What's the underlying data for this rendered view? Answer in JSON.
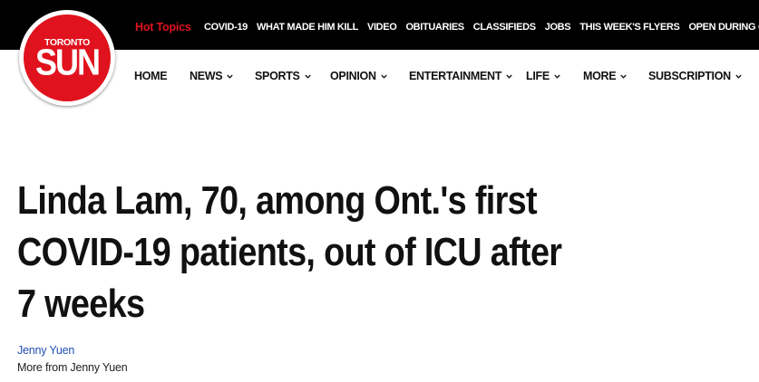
{
  "brand": {
    "logo_top_text": "TORONTO",
    "logo_main_text": "SUN",
    "colors": {
      "red": "#e0121d",
      "black": "#000000",
      "link_blue": "#1f4fb4"
    }
  },
  "topbar": {
    "hot_topics_label": "Hot Topics",
    "topics": [
      "COVID-19",
      "WHAT MADE HIM KILL",
      "VIDEO",
      "OBITUARIES",
      "CLASSIFIEDS",
      "JOBS",
      "THIS WEEK'S FLYERS",
      "OPEN DURING COVID"
    ]
  },
  "nav": {
    "items": [
      {
        "label": "HOME",
        "dropdown": false
      },
      {
        "label": "NEWS",
        "dropdown": true
      },
      {
        "label": "SPORTS",
        "dropdown": true
      },
      {
        "label": "OPINION",
        "dropdown": true
      },
      {
        "label": "ENTERTAINMENT",
        "dropdown": true
      },
      {
        "label": "LIFE",
        "dropdown": true
      },
      {
        "label": "MORE",
        "dropdown": true
      },
      {
        "label": "SUBSCRIPTION",
        "dropdown": true
      }
    ],
    "chevron_icon": "chevron-down-icon"
  },
  "article": {
    "headline_lines": [
      "Linda Lam, 70, among Ont.'s first",
      "COVID-19 patients, out of ICU after",
      "7 weeks"
    ],
    "author": "Jenny Yuen",
    "more_from": "More from Jenny Yuen"
  }
}
